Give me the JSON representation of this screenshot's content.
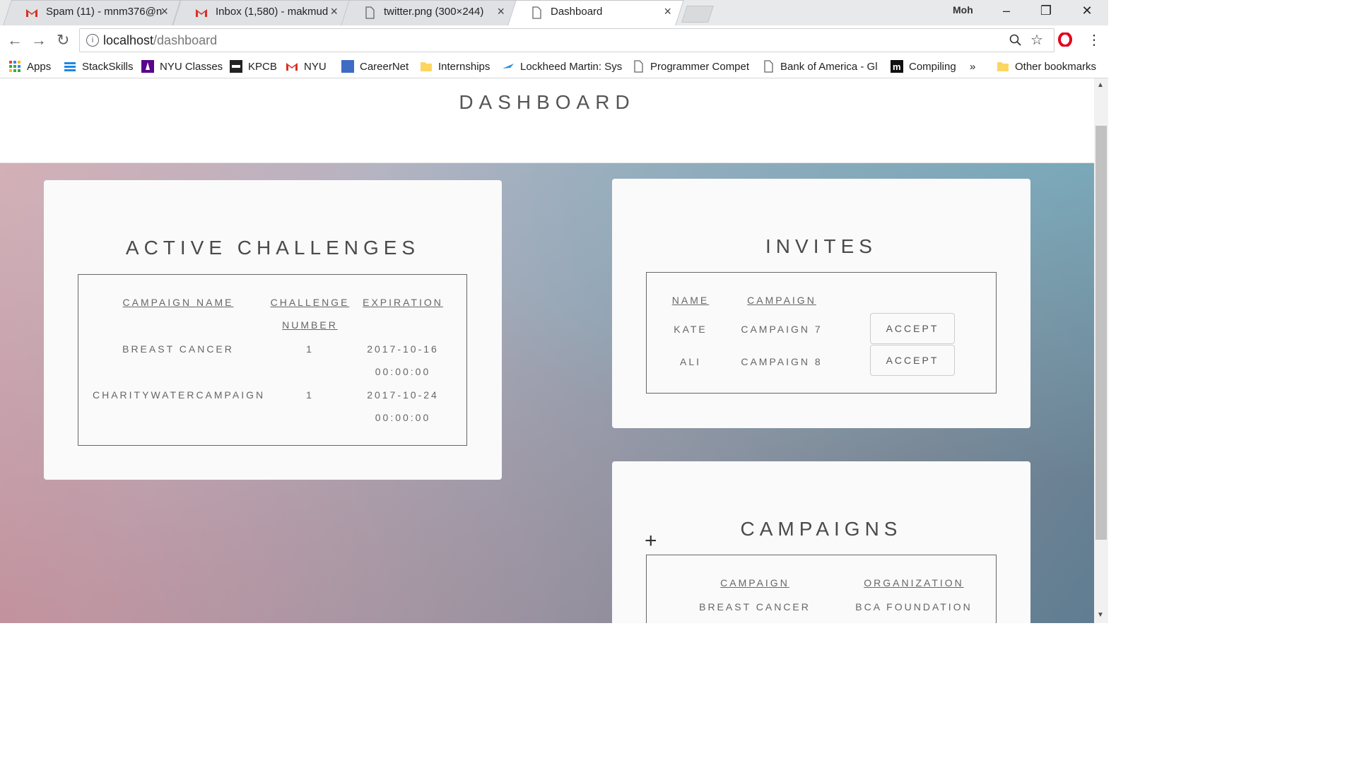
{
  "browser": {
    "tabs": [
      {
        "title": "Spam (11) - mnm376@n",
        "icon": "gmail-icon"
      },
      {
        "title": "Inbox (1,580) - makmud",
        "icon": "gmail-icon"
      },
      {
        "title": "twitter.png (300×244)",
        "icon": "page-icon"
      },
      {
        "title": "Dashboard",
        "icon": "page-icon"
      }
    ],
    "profile_name": "Moh",
    "url_host": "localhost",
    "url_path": "/dashboard",
    "bookmarks": [
      {
        "label": "Apps",
        "icon": "apps-grid-icon"
      },
      {
        "label": "StackSkills",
        "icon": "stackskills-icon"
      },
      {
        "label": "NYU Classes",
        "icon": "nyu-icon"
      },
      {
        "label": "KPCB",
        "icon": "kpcb-icon"
      },
      {
        "label": "NYU",
        "icon": "gmail-icon"
      },
      {
        "label": "CareerNet",
        "icon": "careernet-icon"
      },
      {
        "label": "Internships",
        "icon": "folder-icon"
      },
      {
        "label": "Lockheed Martin: Sys",
        "icon": "lockheed-icon"
      },
      {
        "label": "Programmer Compet",
        "icon": "page-icon"
      },
      {
        "label": "Bank of America - Gl",
        "icon": "page-icon"
      },
      {
        "label": "Compiling",
        "icon": "m-icon"
      },
      {
        "label": "»",
        "icon": "more-icon"
      },
      {
        "label": "Other bookmarks",
        "icon": "folder-icon"
      }
    ]
  },
  "page": {
    "title": "DASHBOARD",
    "active_challenges": {
      "title": "ACTIVE CHALLENGES",
      "headers": [
        "CAMPAIGN NAME",
        "CHALLENGE",
        "NUMBER",
        "EXPIRATION"
      ],
      "rows": [
        {
          "campaign": "BREAST CANCER",
          "number": "1",
          "date": "2017-10-16",
          "time": "00:00:00"
        },
        {
          "campaign": "CHARITYWATERCAMPAIGN",
          "number": "1",
          "date": "2017-10-24",
          "time": "00:00:00"
        }
      ]
    },
    "invites": {
      "title": "INVITES",
      "headers": [
        "NAME",
        "CAMPAIGN"
      ],
      "rows": [
        {
          "name": "KATE",
          "campaign": "CAMPAIGN 7",
          "action": "ACCEPT"
        },
        {
          "name": "ALI",
          "campaign": "CAMPAIGN 8",
          "action": "ACCEPT"
        }
      ]
    },
    "campaigns": {
      "title": "CAMPAIGNS",
      "add_symbol": "+",
      "headers": [
        "CAMPAIGN",
        "ORGANIZATION"
      ],
      "rows": [
        {
          "campaign": "BREAST CANCER",
          "organization": "BCA FOUNDATION"
        }
      ]
    }
  }
}
